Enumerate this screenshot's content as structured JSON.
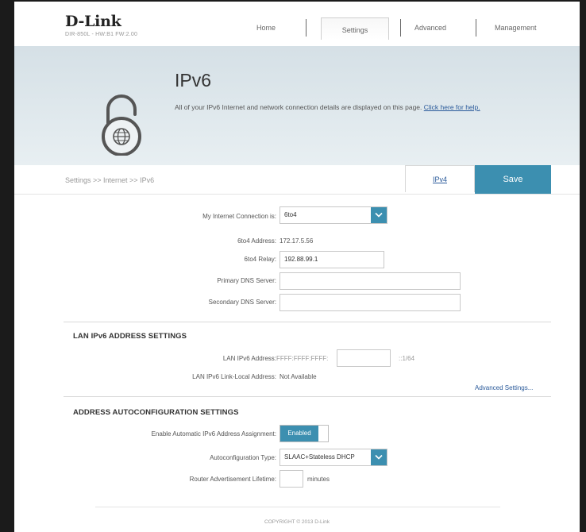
{
  "header": {
    "brand": "D-Link",
    "model": "DIR-850L - HW:B1   FW:2.00",
    "nav": [
      "Home",
      "Settings",
      "Advanced",
      "Management"
    ]
  },
  "banner": {
    "title": "IPv6",
    "description": "All of your IPv6 Internet and network connection details are displayed on this page.",
    "help_link": "Click here for help."
  },
  "toolbar": {
    "breadcrumb": "Settings >> Internet >> IPv6",
    "ipv4_tab": "IPv4",
    "save_label": "Save"
  },
  "form": {
    "connection_label": "My Internet Connection is:",
    "connection_value": "6to4",
    "address_label": "6to4 Address:",
    "address_value": "172.17.5.56",
    "relay_label": "6to4 Relay:",
    "relay_value": "192.88.99.1",
    "primary_dns_label": "Primary DNS Server:",
    "primary_dns_value": "",
    "secondary_dns_label": "Secondary DNS Server:",
    "secondary_dns_value": ""
  },
  "lan": {
    "title": "LAN IPv6 ADDRESS SETTINGS",
    "address_label": "LAN IPv6 Address:",
    "address_prefix": "FFFF:FFFF:FFFF:",
    "address_input": "",
    "address_suffix": "::1/64",
    "link_local_label": "LAN IPv6 Link-Local Address:",
    "link_local_value": "Not Available",
    "advanced_link": "Advanced Settings..."
  },
  "autoconf": {
    "title": "ADDRESS AUTOCONFIGURATION SETTINGS",
    "enable_label": "Enable Automatic IPv6 Address Assignment:",
    "enable_value": "Enabled",
    "type_label": "Autoconfiguration Type:",
    "type_value": "SLAAC+Stateless DHCP",
    "lifetime_label": "Router Advertisement Lifetime:",
    "lifetime_value": "",
    "lifetime_unit": "minutes"
  },
  "footer": {
    "copyright": "COPYRIGHT © 2013 D-Link"
  },
  "colors": {
    "accent": "#3c8fb0",
    "link": "#2a5a9a",
    "banner_bg": "#dde6ea"
  }
}
